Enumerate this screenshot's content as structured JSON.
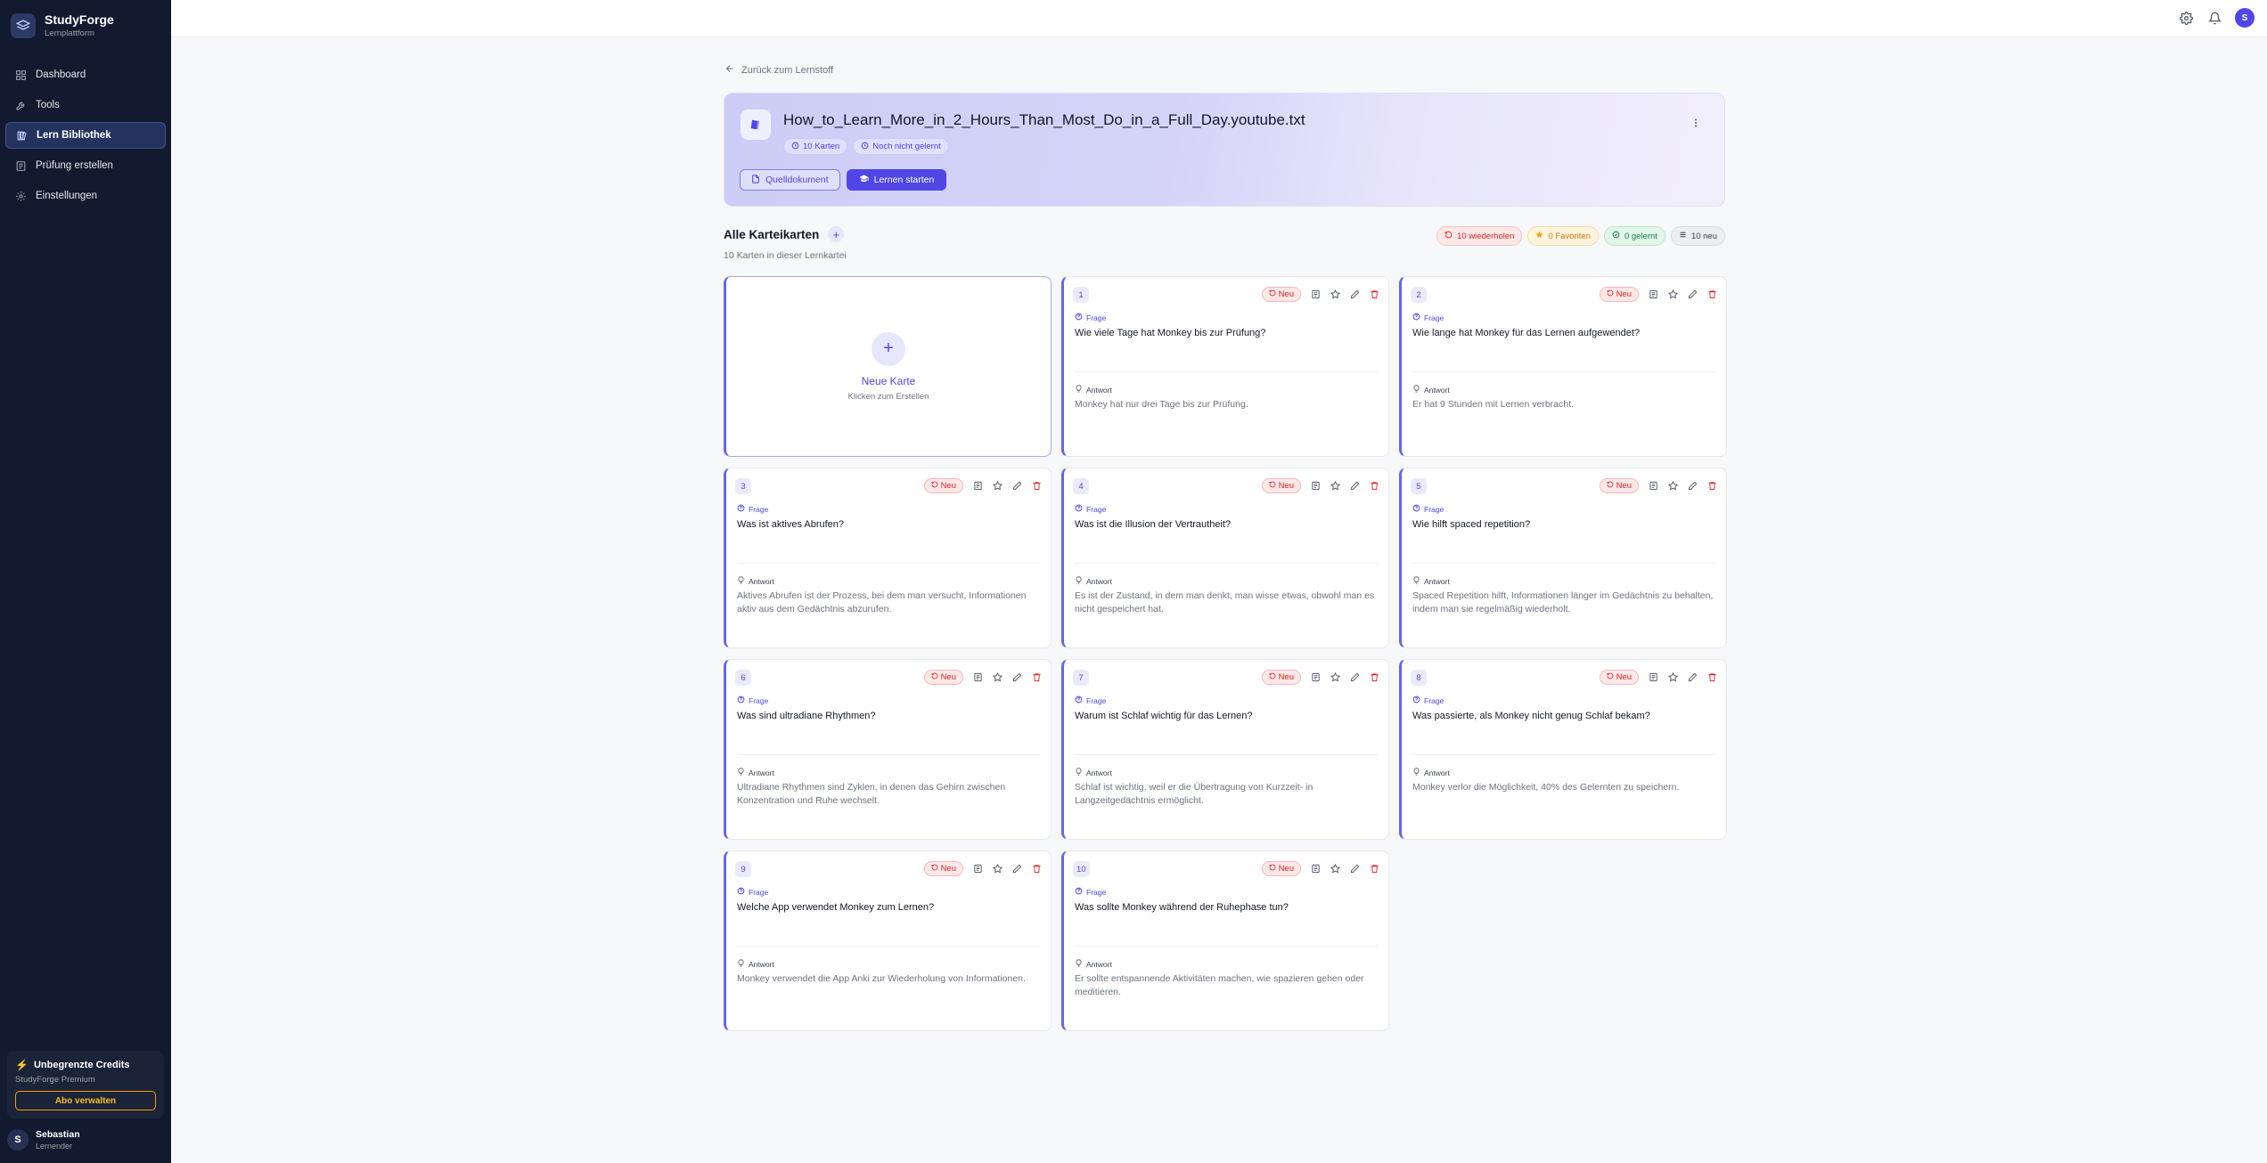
{
  "brand": {
    "name": "StudyForge",
    "subtitle": "Lernplattform"
  },
  "nav": [
    {
      "label": "Dashboard",
      "icon": "grid-icon"
    },
    {
      "label": "Tools",
      "icon": "wrench-icon"
    },
    {
      "label": "Lern Bibliothek",
      "icon": "library-icon",
      "active": true
    },
    {
      "label": "Prüfung erstellen",
      "icon": "exam-icon"
    },
    {
      "label": "Einstellungen",
      "icon": "gear-icon"
    }
  ],
  "credits": {
    "title": "Unbegrenzte Credits",
    "plan": "StudyForge Premium",
    "button": "Abo verwalten"
  },
  "user": {
    "initial": "S",
    "name": "Sebastian",
    "role": "Lernender"
  },
  "topbar": {
    "avatar_initial": "S"
  },
  "back_link": "Zurück zum Lernstoff",
  "deck": {
    "title": "How_to_Learn_More_in_2_Hours_Than_Most_Do_in_a_Full_Day.youtube.txt",
    "cards_chip": "10 Karten",
    "status_chip": "Noch nicht gelernt",
    "source_button": "Quelldokument",
    "start_button": "Lernen starten"
  },
  "section": {
    "title": "Alle Karteikarten",
    "subtitle": "10 Karten in dieser Lernkartei"
  },
  "filters": {
    "repeat": "10 wiederholen",
    "favorites": "0 Favoriten",
    "learned": "0 gelernt",
    "new": "10 neu"
  },
  "new_card": {
    "title": "Neue Karte",
    "subtitle": "Klicken zum Erstellen"
  },
  "labels": {
    "question": "Frage",
    "answer": "Antwort",
    "new_badge": "Neu"
  },
  "colors": {
    "accent": "#4f46e5",
    "sidebar": "#111a2e",
    "danger": "#dc2626",
    "favorite": "#d97706",
    "success": "#15803d"
  },
  "cards": [
    {
      "num": "1",
      "question": "Wie viele Tage hat Monkey bis zur Prüfung?",
      "answer": "Monkey hat nur drei Tage bis zur Prüfung."
    },
    {
      "num": "2",
      "question": "Wie lange hat Monkey für das Lernen aufgewendet?",
      "answer": "Er hat 9 Stunden mit Lernen verbracht."
    },
    {
      "num": "3",
      "question": "Was ist aktives Abrufen?",
      "answer": "Aktives Abrufen ist der Prozess, bei dem man versucht, Informationen aktiv aus dem Gedächtnis abzurufen."
    },
    {
      "num": "4",
      "question": "Was ist die Illusion der Vertrautheit?",
      "answer": "Es ist der Zustand, in dem man denkt, man wisse etwas, obwohl man es nicht gespeichert hat."
    },
    {
      "num": "5",
      "question": "Wie hilft spaced repetition?",
      "answer": "Spaced Repetition hilft, Informationen länger im Gedächtnis zu behalten, indem man sie regelmäßig wiederholt."
    },
    {
      "num": "6",
      "question": "Was sind ultradiane Rhythmen?",
      "answer": "Ultradiane Rhythmen sind Zyklen, in denen das Gehirn zwischen Konzentration und Ruhe wechselt."
    },
    {
      "num": "7",
      "question": "Warum ist Schlaf wichtig für das Lernen?",
      "answer": "Schlaf ist wichtig, weil er die Übertragung von Kurzzeit- in Langzeitgedächtnis ermöglicht."
    },
    {
      "num": "8",
      "question": "Was passierte, als Monkey nicht genug Schlaf bekam?",
      "answer": "Monkey verlor die Möglichkeit, 40% des Gelernten zu speichern."
    },
    {
      "num": "9",
      "question": "Welche App verwendet Monkey zum Lernen?",
      "answer": "Monkey verwendet die App Anki zur Wiederholung von Informationen."
    },
    {
      "num": "10",
      "question": "Was sollte Monkey während der Ruhephase tun?",
      "answer": "Er sollte entspannende Aktivitäten machen, wie spazieren gehen oder meditieren."
    }
  ]
}
